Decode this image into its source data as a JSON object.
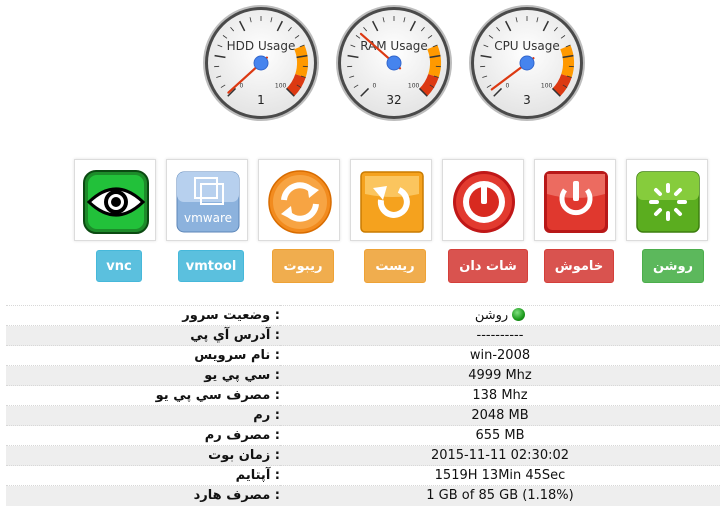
{
  "gauges": [
    {
      "label": "HDD Usage",
      "value": "1",
      "min": "0",
      "max": "100",
      "percent": 1
    },
    {
      "label": "RAM Usage",
      "value": "32",
      "min": "0",
      "max": "100",
      "percent": 32
    },
    {
      "label": "CPU Usage",
      "value": "3",
      "min": "0",
      "max": "100",
      "percent": 3
    }
  ],
  "actions": [
    {
      "id": "vnc",
      "label": "vnc",
      "icon": "eye-icon",
      "style": "info"
    },
    {
      "id": "vmtool",
      "label": "vmtool",
      "icon": "vmware-icon",
      "style": "info",
      "icon_text": "vmware"
    },
    {
      "id": "reboot",
      "label": "ريبوت",
      "icon": "refresh-icon",
      "style": "warning"
    },
    {
      "id": "reset",
      "label": "ريست",
      "icon": "reset-icon",
      "style": "warning"
    },
    {
      "id": "shutdown",
      "label": "شات دان",
      "icon": "power-icon",
      "style": "danger"
    },
    {
      "id": "poweroff",
      "label": "خاموش",
      "icon": "power-off-icon",
      "style": "danger"
    },
    {
      "id": "poweron",
      "label": "روشن",
      "icon": "loading-icon",
      "style": "success"
    }
  ],
  "server_info": {
    "status": {
      "label": ": وضعيت سرور",
      "value": "روشن"
    },
    "ip": {
      "label": ": آدرس آي پي",
      "value": "----------"
    },
    "service_name": {
      "label": ": نام سرويس",
      "value": "win-2008"
    },
    "cpu": {
      "label": ": سي پي يو",
      "value": "4999 Mhz"
    },
    "cpu_usage": {
      "label": ": مصرف سي پي يو",
      "value": "138 Mhz"
    },
    "ram": {
      "label": ": رم",
      "value": "2048 MB"
    },
    "ram_usage": {
      "label": ": مصرف رم",
      "value": "655 MB"
    },
    "boot_time": {
      "label": ": زمان بوت",
      "value": "2015-11-11 02:30:02"
    },
    "uptime": {
      "label": ": آپتايم",
      "value": "1519H 13Min 45Sec"
    },
    "disk_usage": {
      "label": ": مصرف هارد",
      "value": "1 GB of 85 GB (1.18%)"
    }
  },
  "colors": {
    "info": "#5bc0de",
    "warning": "#f0ad4e",
    "danger": "#d9534f",
    "success": "#5cb85c",
    "gauge_yellow": "#ff9900",
    "gauge_red": "#dc3912",
    "needle": "#dc3912",
    "needle_cap": "#4684ee"
  }
}
